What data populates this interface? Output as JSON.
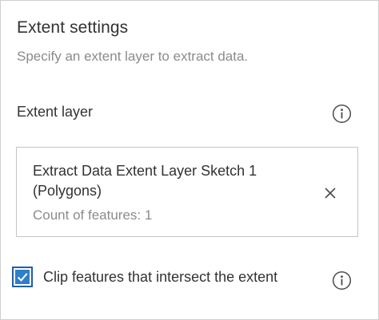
{
  "section": {
    "title": "Extent settings",
    "description": "Specify an extent layer to extract data."
  },
  "extent_layer": {
    "label": "Extent layer",
    "info_icon": "info-icon",
    "selected_layer": {
      "name": "Extract Data Extent Layer Sketch 1 (Polygons)",
      "count_text": "Count of features: 1",
      "remove_icon": "close-icon"
    }
  },
  "clip_option": {
    "checked": true,
    "label": "Clip features that intersect the extent",
    "info_icon": "info-icon"
  },
  "colors": {
    "checkbox_border": "#1e5fa8",
    "checkbox_fill": "#2f7fc8",
    "text_primary": "#323232",
    "text_secondary": "#8b8b8b",
    "border": "#c4c4c4"
  }
}
